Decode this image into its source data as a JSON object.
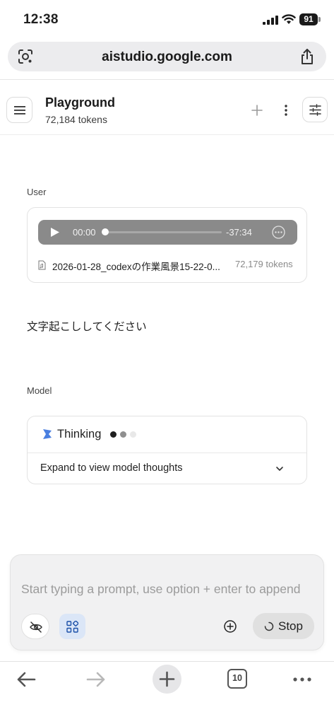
{
  "status_bar": {
    "time": "12:38",
    "battery": "91",
    "icons": [
      "signal-icon",
      "wifi-icon",
      "battery-icon"
    ]
  },
  "browser": {
    "url": "aistudio.google.com",
    "icons": {
      "left": "lens-icon",
      "right": "share-icon"
    },
    "tab_count": "10",
    "toolbar": [
      "back-icon",
      "forward-icon",
      "new-tab-icon",
      "tabs-icon",
      "more-icon"
    ]
  },
  "header": {
    "title": "Playground",
    "tokens": "72,184 tokens",
    "icons": [
      "menu-icon",
      "plus-icon",
      "kebab-icon",
      "tune-icon"
    ]
  },
  "user_turn": {
    "role": "User",
    "audio": {
      "current": "00:00",
      "remaining": "-37:34",
      "progress": 0.0
    },
    "file": {
      "name": "2026-01-28_codexの作業風景15-22-0...",
      "tokens": "72,179 tokens"
    },
    "message": "文字起こししてください"
  },
  "model_turn": {
    "role": "Model",
    "status": "Thinking",
    "expand_label": "Expand to view model thoughts"
  },
  "composer": {
    "placeholder": "Start typing a prompt, use option + enter to append",
    "stop_label": "Stop"
  },
  "colors": {
    "accent_light": "#dbe6f7",
    "spark": "#4a7fe0",
    "audio_player": "#8a8a8a"
  }
}
